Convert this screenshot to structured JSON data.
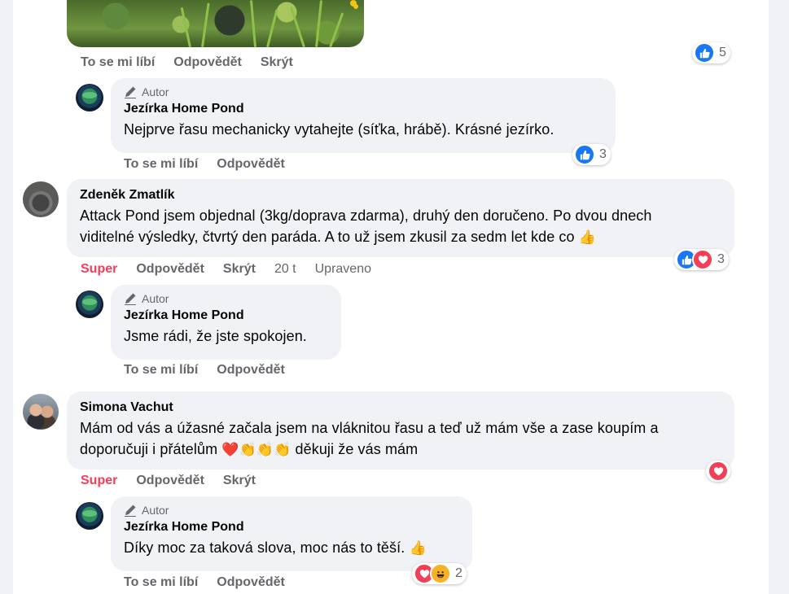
{
  "actions": {
    "like": "To se mi líbí",
    "reply": "Odpovědět",
    "hide": "Skrýt",
    "super": "Super"
  },
  "author_badge": "Autor",
  "top_post": {
    "reaction_count": "5"
  },
  "comments": [
    {
      "name": "Jezírka Home Pond",
      "text": "Nejprve řasu mechanicky vytahejte (síťka, hrábě). Krásné jezírko.",
      "reaction_count": "3"
    },
    {
      "name": "Zdeněk Zmatlík",
      "text_line1": "Attack Pond jsem objednal (3kg/doprava zdarma), druhý den doručeno. Po dvou dnech",
      "text_line2": "viditelné výsledky, čtvrtý den paráda. A to už jsem zkusil za sedm let kde co",
      "emoji": "👍",
      "time": "20 t",
      "edited": "Upraveno",
      "reaction_count": "3"
    },
    {
      "name": "Jezírka Home Pond",
      "text": "Jsme rádi, že jste spokojen."
    },
    {
      "name": "Simona Vachut",
      "text_line1": "Mám od vás a úžasné začala jsem na vláknitou řasu a teď už mám vše a zase koupím a",
      "text_line2_a": "doporučuji i přátelům",
      "emojis": "❤️👏👏👏",
      "text_line2_b": "děkuji že vás mám"
    },
    {
      "name": "Jezírka Home Pond",
      "text": "Díky moc za taková slova, moc nás to těší.",
      "emoji": "👍",
      "reaction_count": "2"
    }
  ],
  "colors": {
    "like_blue": "#1877f2",
    "super_red": "#f33e58",
    "meta_gray": "#65676b",
    "bubble_bg": "#f0f2f5"
  }
}
